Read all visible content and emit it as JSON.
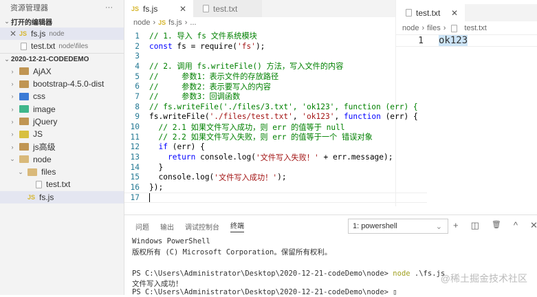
{
  "sidebar": {
    "title": "资源管理器",
    "more": "···",
    "open_editors": "打开的编辑器",
    "open": [
      {
        "name": "fs.js",
        "desc": "node",
        "icon": "js"
      },
      {
        "name": "test.txt",
        "desc": "node\\files",
        "icon": "txt"
      }
    ],
    "project": "2020-12-21-CODEDEMO",
    "tree": [
      {
        "name": "AjAX",
        "icon": "folder",
        "depth": 0
      },
      {
        "name": "bootstrap-4.5.0-dist",
        "icon": "folder",
        "depth": 0
      },
      {
        "name": "css",
        "icon": "css",
        "depth": 0
      },
      {
        "name": "image",
        "icon": "image",
        "depth": 0
      },
      {
        "name": "jQuery",
        "icon": "folder",
        "depth": 0
      },
      {
        "name": "JS",
        "icon": "jsfolder",
        "depth": 0
      },
      {
        "name": "js高级",
        "icon": "folder",
        "depth": 0
      },
      {
        "name": "node",
        "icon": "folder-open",
        "depth": 0,
        "open": true
      },
      {
        "name": "files",
        "icon": "folder-open",
        "depth": 1,
        "open": true
      },
      {
        "name": "test.txt",
        "icon": "txt",
        "depth": 2
      },
      {
        "name": "fs.js",
        "icon": "js",
        "depth": 1,
        "selected": true
      }
    ]
  },
  "editor": {
    "tabs": [
      {
        "label": "fs.js",
        "icon": "JS"
      },
      {
        "label": "test.txt"
      }
    ],
    "close": "✕",
    "breadcrumb": [
      "node",
      "›",
      "JS",
      "fs.js",
      "›",
      "..."
    ],
    "lines": [
      [
        [
          "c",
          "// 1. 导入 fs 文件系统模块"
        ]
      ],
      [
        [
          "k",
          "const"
        ],
        [
          "p",
          " fs = require("
        ],
        [
          "s",
          "'fs'"
        ],
        [
          "p",
          ");"
        ]
      ],
      [],
      [
        [
          "c",
          "// 2. 调用 fs.writeFile() 方法，写入文件的内容"
        ]
      ],
      [
        [
          "c",
          "//     参数1：表示文件的存放路径"
        ]
      ],
      [
        [
          "c",
          "//     参数2：表示要写入的内容"
        ]
      ],
      [
        [
          "c",
          "//     参数3：回调函数"
        ]
      ],
      [
        [
          "c",
          "// fs.writeFile('./files/3.txt', 'ok123', function (err) {"
        ]
      ],
      [
        [
          "p",
          "fs.writeFile("
        ],
        [
          "s",
          "'./files/test.txt'"
        ],
        [
          "p",
          ", "
        ],
        [
          "s",
          "'ok123'"
        ],
        [
          "p",
          ", "
        ],
        [
          "k",
          "function"
        ],
        [
          "p",
          " (err) {"
        ]
      ],
      [
        [
          "p",
          "  "
        ],
        [
          "c",
          "// 2.1 如果文件写入成功，则 err 的值等于 null"
        ]
      ],
      [
        [
          "p",
          "  "
        ],
        [
          "c",
          "// 2.2 如果文件写入失败，则 err 的值等于一个 错误对象"
        ]
      ],
      [
        [
          "p",
          "  "
        ],
        [
          "k",
          "if"
        ],
        [
          "p",
          " (err) {"
        ]
      ],
      [
        [
          "p",
          "    "
        ],
        [
          "k",
          "return"
        ],
        [
          "p",
          " console.log("
        ],
        [
          "s",
          "'文件写入失败！'"
        ],
        [
          "p",
          " + err.message);"
        ]
      ],
      [
        [
          "p",
          "  }"
        ]
      ],
      [
        [
          "p",
          "  console.log("
        ],
        [
          "s",
          "'文件写入成功！'"
        ],
        [
          "p",
          ");"
        ]
      ],
      [
        [
          "p",
          "});"
        ]
      ],
      []
    ]
  },
  "right": {
    "tab": "test.txt",
    "close": "✕",
    "breadcrumb": [
      "node",
      "›",
      "files",
      "›",
      "test.txt"
    ],
    "line_no": "1",
    "content": "ok123"
  },
  "panel": {
    "tabs": [
      "问题",
      "输出",
      "调试控制台",
      "终端"
    ],
    "active": 3,
    "terminal_select": "1: powershell",
    "icons": [
      "+",
      "◫",
      "🗑",
      "^",
      "✕"
    ],
    "terminal": [
      "Windows PowerShell",
      "版权所有 (C) Microsoft Corporation。保留所有权利。",
      "",
      "PS C:\\Users\\Administrator\\Desktop\\2020-12-21-codeDemo\\node> node .\\fs.js",
      "文件写入成功！",
      "PS C:\\Users\\Administrator\\Desktop\\2020-12-21-codeDemo\\node> ▯"
    ]
  },
  "watermark": "@稀土掘金技术社区"
}
